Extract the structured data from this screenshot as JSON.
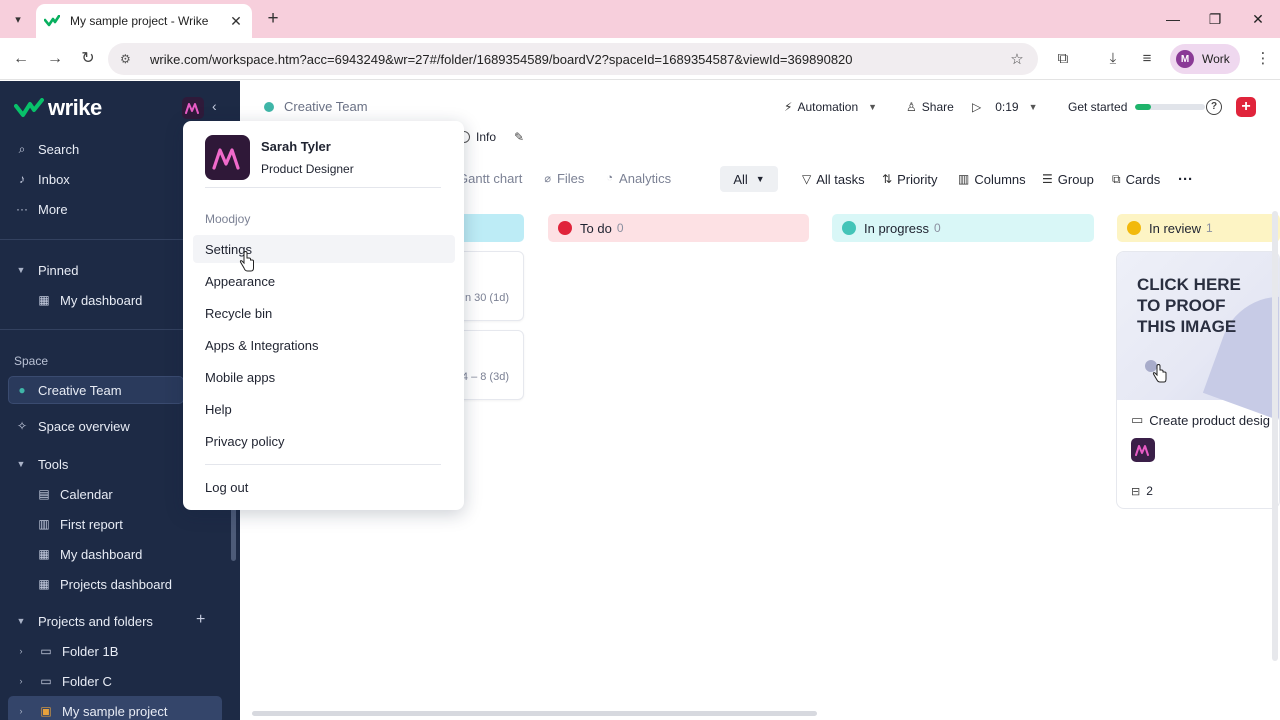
{
  "browser": {
    "tab_title": "My sample project - Wrike",
    "url": "wrike.com/workspace.htm?acc=6943249&wr=27#/folder/1689354589/boardV2?spaceId=1689354587&viewId=369890820",
    "profile_initial": "M",
    "profile_label": "Work"
  },
  "sidebar": {
    "logo": "wrike",
    "nav": [
      {
        "label": "Search",
        "icon": "search-icon"
      },
      {
        "label": "Inbox",
        "icon": "bell-icon"
      },
      {
        "label": "More",
        "icon": "more-icon"
      }
    ],
    "pinned_label": "Pinned",
    "pinned_items": [
      {
        "label": "My dashboard",
        "icon": "dashboard-icon"
      }
    ],
    "space_section": "Space",
    "space_name": "Creative Team",
    "space_overview": "Space overview",
    "tools_label": "Tools",
    "tools": [
      {
        "label": "Calendar",
        "icon": "calendar-icon"
      },
      {
        "label": "First report",
        "icon": "report-icon"
      },
      {
        "label": "My dashboard",
        "icon": "dashboard-icon"
      },
      {
        "label": "Projects dashboard",
        "icon": "dashboard-icon"
      }
    ],
    "projects_label": "Projects and folders",
    "folders": [
      {
        "label": "Folder 1B",
        "icon": "folder-icon"
      },
      {
        "label": "Folder C",
        "icon": "folder-icon"
      },
      {
        "label": "My sample project",
        "icon": "project-icon"
      }
    ]
  },
  "header": {
    "breadcrumb": "Creative Team",
    "automation": "Automation",
    "share": "Share",
    "timer": "0:19",
    "get_started": "Get started",
    "get_started_progress": 0.22,
    "info": "Info"
  },
  "views": {
    "tabs": [
      {
        "label": "Gantt chart",
        "icon": "gantt-icon"
      },
      {
        "label": "Files",
        "icon": "paperclip-icon"
      },
      {
        "label": "Analytics",
        "icon": "analytics-icon"
      }
    ],
    "filter": "All",
    "tools": [
      {
        "label": "All tasks",
        "icon": "filter-icon"
      },
      {
        "label": "Priority",
        "icon": "sort-icon"
      },
      {
        "label": "Columns",
        "icon": "columns-icon"
      },
      {
        "label": "Group",
        "icon": "group-icon"
      },
      {
        "label": "Cards",
        "icon": "cards-icon"
      }
    ]
  },
  "board": {
    "columns": [
      {
        "label": "To do",
        "count": "0",
        "bg": "#fde1e4",
        "dot": "#e0243b"
      },
      {
        "label": "In progress",
        "count": "0",
        "bg": "#d9f7f7",
        "dot": "#43c4b8"
      },
      {
        "label": "In review",
        "count": "1",
        "bg": "#fdf4c4",
        "dot": "#f2b90c"
      }
    ],
    "partial_cards": [
      {
        "date": "n 30 (1d)"
      },
      {
        "date": "4 – 8 (3d)"
      }
    ],
    "proof_card": {
      "image_text": "CLICK HERE TO PROOF THIS IMAGE",
      "title": "Create product desig",
      "subtasks": "2"
    }
  },
  "account_menu": {
    "name": "Sarah Tyler",
    "role": "Product Designer",
    "org": "Moodjoy",
    "items": [
      "Settings",
      "Appearance",
      "Recycle bin",
      "Apps & Integrations",
      "Mobile apps",
      "Help",
      "Privacy policy"
    ],
    "logout": "Log out"
  }
}
